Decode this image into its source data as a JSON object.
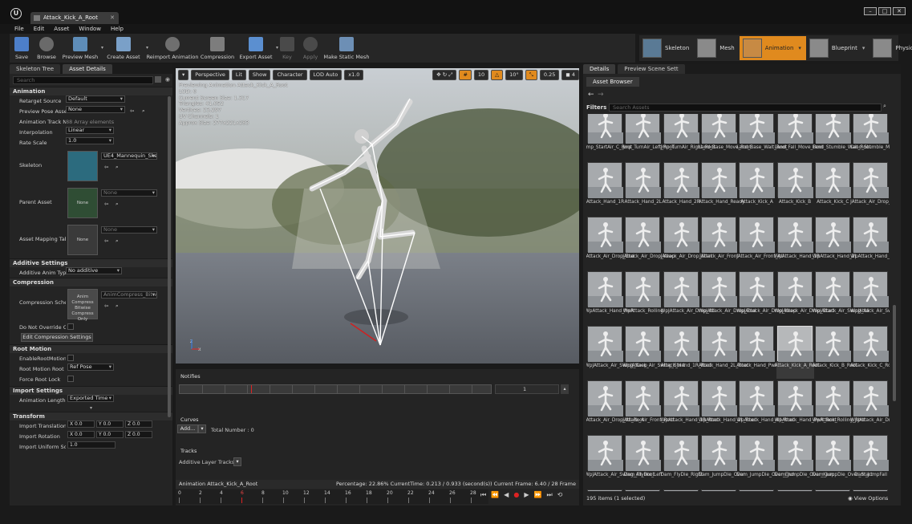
{
  "window": {
    "tab_title": "Attack_Kick_A_Root",
    "logo": "U"
  },
  "menu": [
    "File",
    "Edit",
    "Asset",
    "Window",
    "Help"
  ],
  "toolbar": [
    {
      "label": "Save",
      "icon": "save-icon",
      "enabled": true
    },
    {
      "label": "Browse",
      "icon": "browse-icon",
      "enabled": true
    },
    {
      "label": "Preview Mesh",
      "icon": "preview-mesh-icon",
      "enabled": true,
      "dropdown": true
    },
    {
      "label": "Create Asset",
      "icon": "create-asset-icon",
      "enabled": true,
      "dropdown": true
    },
    {
      "label": "Reimport Animation",
      "icon": "reimport-icon",
      "enabled": true
    },
    {
      "label": "Compression",
      "icon": "compression-icon",
      "enabled": true
    },
    {
      "label": "Export Asset",
      "icon": "export-icon",
      "enabled": true,
      "dropdown": true
    },
    {
      "label": "Key",
      "icon": "key-icon",
      "enabled": false
    },
    {
      "label": "Apply",
      "icon": "apply-icon",
      "enabled": false
    },
    {
      "label": "Make Static Mesh",
      "icon": "static-mesh-icon",
      "enabled": true
    }
  ],
  "modes": [
    {
      "label": "Skeleton",
      "active": false
    },
    {
      "label": "Mesh",
      "active": false
    },
    {
      "label": "Animation",
      "active": true
    },
    {
      "label": "Blueprint",
      "active": false
    },
    {
      "label": "Physics",
      "active": false
    }
  ],
  "left_panel": {
    "tabs": [
      "Skeleton Tree",
      "Asset Details"
    ],
    "search_placeholder": "Search",
    "sections": {
      "animation": "Animation",
      "additive": "Additive Settings",
      "compression": "Compression",
      "root_motion": "Root Motion",
      "import": "Import Settings",
      "transform": "Transform"
    },
    "props": {
      "retarget_label": "Retarget Source",
      "retarget_value": "Default",
      "preview_pose_label": "Preview Pose Asse",
      "preview_pose_value": "None",
      "track_names_label": "Animation Track N",
      "track_names_value": "88 Array elements",
      "interp_label": "Interpolation",
      "interp_value": "Linear",
      "rate_label": "Rate Scale",
      "rate_value": "1.0",
      "skeleton_label": "Skeleton",
      "skeleton_value": "UE4_Mannequin_Skel",
      "parent_label": "Parent Asset",
      "parent_value": "None",
      "parent_thumb": "None",
      "mapping_label": "Asset Mapping Tab",
      "mapping_value": "None",
      "mapping_thumb": "None",
      "additive_label": "Additive Anim Type",
      "additive_value": "No additive",
      "comp_label": "Compression Schei",
      "comp_value": "AnimCompress_Bitwi",
      "comp_thumb": "Anim Compress Bitwise Compress Only",
      "override_label": "Do Not Override Co",
      "edit_comp_button": "Edit Compression Settings",
      "enable_rm_label": "EnableRootMotion",
      "rm_lock_label": "Root Motion Root L",
      "rm_lock_value": "Ref Pose",
      "force_lock_label": "Force Root Lock",
      "anim_length_label": "Animation Length",
      "anim_length_value": "Exported Time",
      "imp_translation_label": "Import Translation",
      "imp_rotation_label": "Import Rotation",
      "imp_scale_label": "Import Uniform Sca",
      "imp_scale_value": "1.0",
      "vx": "X 0.0",
      "vy": "Y 0.0",
      "vz": "Z 0.0"
    }
  },
  "viewport": {
    "perspective": "Perspective",
    "lit": "Lit",
    "show": "Show",
    "character": "Character",
    "lod": "LOD Auto",
    "speed": "x1.0",
    "grid_snap": "10",
    "rot_snap": "10°",
    "scale_snap": "0.25",
    "info": [
      "Previewing Animation Attack_Kick_A_Root",
      "LOD: 0",
      "Current Screen Size: 1.317",
      "Triangles: 41,052",
      "Vertices: 23,297",
      "UV Channels: 1",
      "Approx Size: 277x221x283"
    ]
  },
  "editor": {
    "notifies": "Notifies",
    "curves": "Curves",
    "add": "Add...",
    "total": "Total Number : 0",
    "tracks": "Tracks",
    "layer_tracks": "Additive Layer Tracks",
    "track_count": "1",
    "status_anim": "Animation   Attack_Kick_A_Root",
    "status_pct": "Percentage:  22.86% CurrentTime:  0.213 / 0.933 (second(s)) Current Frame:  6.40 / 28 Frame",
    "ruler": [
      "0",
      "2",
      "4",
      "6",
      "8",
      "10",
      "12",
      "14",
      "16",
      "18",
      "20",
      "22",
      "24",
      "26",
      "28"
    ]
  },
  "right_panel": {
    "tabs": [
      "Details",
      "Preview Scene Sett"
    ],
    "browser_tab": "Asset Browser",
    "filters": "Filters",
    "search_placeholder": "Search Assets",
    "assets": [
      "Jmp_StartAir_C_Root",
      "Jmp_TurnAir_Left_Root",
      "Jmp_TurnAir_Right_Root",
      "Land_Base_Move_Root",
      "Land_Base_Wait_Root",
      "Land_Fall_Move_Root",
      "Land_Stumble_Wait_Root",
      "Land_Stumble_Move_Root",
      "Attack_Hand_1R",
      "Attack_Hand_2L",
      "Attack_Hand_2R",
      "Attack_Hand_Ready",
      "Attack_Kick_A",
      "Attack_Kick_B",
      "Attack_Kick_C",
      "JAttack_Air_Drop_All",
      "JAttack_Air_Drop_End",
      "JAttack_Air_Drop_Keep",
      "JAttack_Air_Drop_Start",
      "JAttack_Air_Front",
      "JAttack_Air_Front_All",
      "WpAttack_Hand_1R",
      "WpAttack_Hand_2L",
      "WpAttack_Hand_All",
      "WpAttack_Hand_PwR",
      "WpAttack_Rolling",
      "WpJAttack_Air_Drop_All",
      "WpJAttack_Air_Drop_End",
      "WpJAttack_Air_Drop_Keep",
      "WpJAttack_Air_Drop_Start",
      "WpJAttack_Air_Swing_All",
      "WpJAttack_Air_Swing_End",
      "WpJAttack_Air_Swing_Keep",
      "WpJAttack_Air_Swing_Start",
      "Attack_Hand_1R_Root",
      "Attack_Hand_2L_Root",
      "Attack_Hand_PwR_Root",
      "Attack_Kick_A_Root",
      "Attack_Kick_B_Root",
      "Attack_Kick_C_Root",
      "JAttack_Air_Drop_All_Root",
      "JAttack_Air_Front_Root",
      "WpAttack_Hand_1R_Root",
      "WpAttack_Hand_2L_Root",
      "WpAttack_Hand_All_Root",
      "WpAttack_Hand_PwR_Root",
      "WpAttack_Rolling_Root",
      "WpJAttack_Air_Drop_All_Root",
      "WpJAttack_Air_Swing_All_Root",
      "Dam_FlyDie_Left",
      "Dam_FlyDie_Right",
      "Dam_JumpDie_Over",
      "Dam_JumpDie_Over_End",
      "Dam_JumpDie_Over_Keep",
      "Dam_JumpDie_Over_Start",
      "Dam_JumpFall",
      "",
      "",
      "",
      "",
      "",
      "",
      "",
      ""
    ],
    "selected_index": 37,
    "footer": "195 items (1 selected)",
    "view_options": "View Options"
  }
}
